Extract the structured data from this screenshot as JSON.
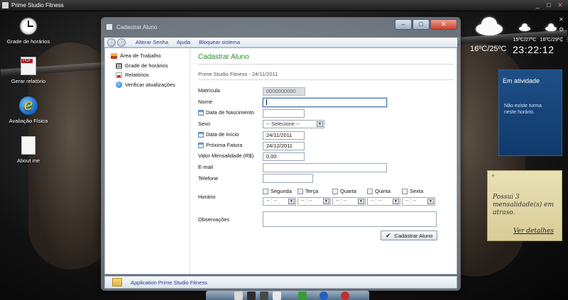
{
  "topbar": {
    "title": "Prime Studio Fitness",
    "ctrl_min": "_",
    "ctrl_max": "□",
    "ctrl_close": "✕"
  },
  "desktop": {
    "icons": [
      {
        "label": "Grade de horários"
      },
      {
        "label": "Gerar relatório"
      },
      {
        "label": "Avaliação Física"
      },
      {
        "label": "About me"
      }
    ]
  },
  "window": {
    "title": "Cadastrar Aluno",
    "ctrl_min": "–",
    "ctrl_max": "□",
    "ctrl_close": "✕",
    "nav_back": "‹",
    "nav_forward": "›",
    "menu": [
      "Alterar Senha",
      "Ajuda",
      "Bloquear sistema"
    ]
  },
  "sidebar": {
    "items": [
      {
        "label": "Área de Trabalho"
      },
      {
        "label": "Grade de horários"
      },
      {
        "label": "Relatórios"
      },
      {
        "label": "Verificar atualizações"
      }
    ]
  },
  "form": {
    "title": "Cadastrar Aluno",
    "subtitle": "Prime Studio Fitness - 24/11/2011",
    "fields": {
      "matricula": {
        "label": "Matrícula",
        "value": "0000000000"
      },
      "nome": {
        "label": "Nome",
        "value": ""
      },
      "nascimento": {
        "label": "Data de Nascimento",
        "value": ""
      },
      "sexo": {
        "label": "Sexo",
        "value": "-- Selecione --"
      },
      "inicio": {
        "label": "Data de Início",
        "value": "24/11/2011"
      },
      "fatura": {
        "label": "Próxima Fatura",
        "value": "24/12/2011"
      },
      "mensalidade": {
        "label": "Valor Mensalidade (R$)",
        "value": "0,00"
      },
      "email": {
        "label": "E-mail",
        "value": ""
      },
      "telefone": {
        "label": "Telefone",
        "value": ""
      },
      "horario": {
        "label": "Horário"
      },
      "observacoes": {
        "label": "Observações",
        "value": ""
      }
    },
    "days": [
      "Segunda",
      "Terça",
      "Quarta",
      "Quinta",
      "Sexta"
    ],
    "time_placeholder": "-- : --",
    "dropdown_arrow": "▼",
    "submit_label": "Cadastrar Aluno",
    "submit_icon": "✔"
  },
  "statusbar": {
    "text": "Application Prime Studio Fitness"
  },
  "gadgets": {
    "weather_main": "16ºC/25ºC",
    "weather_day1": "15ºC/27ºC",
    "weather_day2": "16ºC/29ºC",
    "clock": "23:22:12",
    "gadget_close": "✕",
    "gadget_tool": "⚙",
    "gadget_drag": "⋮⋮",
    "activity_title": "Em atividade",
    "activity_body": "Não existe turma neste horário.",
    "note_plus": "+",
    "note_text": "Possui 3 mensalidade(s) em atraso.",
    "note_link": "Ver detalhes"
  },
  "colors": {
    "form_title": "#2a8a2a",
    "menu_link": "#1c3e88",
    "activity_bg": "#1d4f86",
    "note_bg": "#e9e0b5"
  }
}
